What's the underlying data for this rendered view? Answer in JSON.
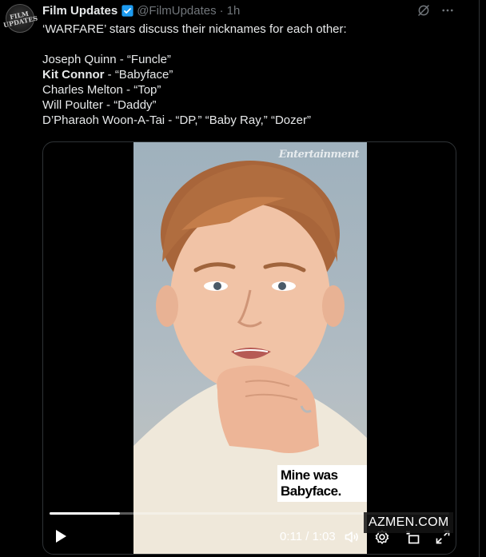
{
  "tweet": {
    "author_name": "Film Updates",
    "handle": "@FilmUpdates",
    "separator": "·",
    "time": "1h",
    "avatar_text": "FILM UPDATES",
    "text_intro": "‘WARFARE’ stars discuss their nicknames for each other:",
    "lines": [
      {
        "name": "Joseph Quinn",
        "rest": " - “Funcle”"
      },
      {
        "name": "Kit Connor",
        "rest": " - “Babyface”"
      },
      {
        "name": "Charles Melton",
        "rest": " - “Top”"
      },
      {
        "name": "Will Poulter",
        "rest": " - “Daddy”"
      },
      {
        "name": "D’Pharaoh Woon-A-Tai",
        "rest": " - “DP,” “Baby Ray,” “Dozer”"
      }
    ]
  },
  "video": {
    "caption": "Mine was Babyface.",
    "watermark": "Entertainment",
    "current_time": "0:11",
    "duration": "1:03",
    "time_label": "0:11 / 1:03",
    "progress": 0.175,
    "overlay_watermark": "AZMEN.COM"
  },
  "icons": {
    "verified": "verified-badge-icon",
    "grok": "grok-icon",
    "more": "more-icon",
    "play": "play-icon",
    "volume": "volume-icon",
    "settings": "settings-icon",
    "pip": "picture-in-picture-icon",
    "fullscreen": "fullscreen-icon"
  },
  "colors": {
    "background": "#000000",
    "text": "#e7e9ea",
    "muted": "#71767b",
    "verified": "#1d9bf0"
  }
}
